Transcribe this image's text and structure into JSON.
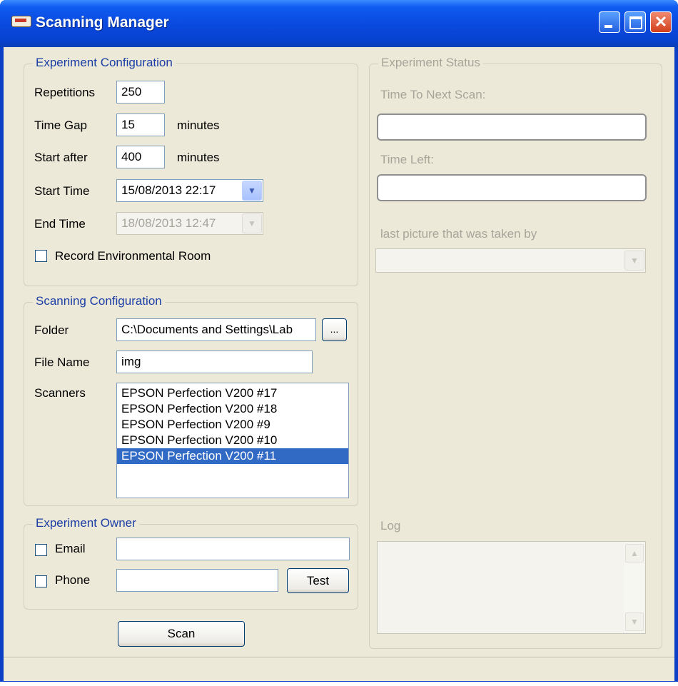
{
  "window": {
    "title": "Scanning Manager",
    "controls": [
      "minimize",
      "maximize",
      "close"
    ]
  },
  "experiment_configuration": {
    "legend": "Experiment Configuration",
    "repetitions_label": "Repetitions",
    "repetitions_value": "250",
    "time_gap_label": "Time Gap",
    "time_gap_value": "15",
    "time_gap_unit": "minutes",
    "start_after_label": "Start after",
    "start_after_value": "400",
    "start_after_unit": "minutes",
    "start_time_label": "Start Time",
    "start_time_value": "15/08/2013 22:17",
    "end_time_label": "End Time",
    "end_time_value": "18/08/2013 12:47",
    "record_env_label": "Record Environmental Room",
    "record_env_checked": false
  },
  "scanning_configuration": {
    "legend": "Scanning Configuration",
    "folder_label": "Folder",
    "folder_value": "C:\\Documents and Settings\\Lab",
    "browse_label": "...",
    "file_name_label": "File Name",
    "file_name_value": "img",
    "scanners_label": "Scanners",
    "scanners": [
      {
        "name": "EPSON Perfection V200 #17",
        "selected": false
      },
      {
        "name": "EPSON Perfection V200 #18",
        "selected": false
      },
      {
        "name": "EPSON Perfection V200 #9",
        "selected": false
      },
      {
        "name": "EPSON Perfection V200 #10",
        "selected": false
      },
      {
        "name": "EPSON Perfection V200 #11",
        "selected": true
      }
    ]
  },
  "experiment_owner": {
    "legend": "Experiment Owner",
    "email_label": "Email",
    "email_value": "",
    "phone_label": "Phone",
    "phone_value": "",
    "test_label": "Test"
  },
  "scan_button_label": "Scan",
  "experiment_status": {
    "legend": "Experiment Status",
    "time_to_next_label": "Time To Next Scan:",
    "time_to_next_value": "",
    "time_left_label": "Time Left:",
    "time_left_value": "",
    "last_picture_label": "last picture that was taken by",
    "last_picture_value": "",
    "log_label": "Log"
  },
  "colors": {
    "title_bar": "#0a48dd",
    "window_bg": "#ece9d8",
    "group_legend": "#1b3ea6",
    "selection": "#316ac5",
    "disabled_text": "#a7a59a"
  }
}
